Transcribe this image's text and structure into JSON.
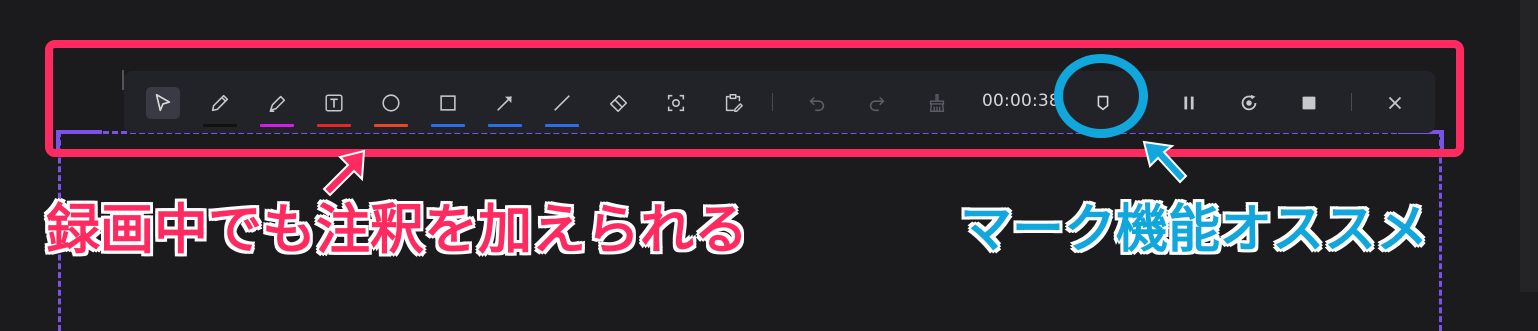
{
  "toolbar": {
    "timer": "00:00:38",
    "tools": [
      {
        "id": "select",
        "icon": "cursor-icon",
        "swatch": null
      },
      {
        "id": "pen",
        "icon": "pencil-icon",
        "swatch": "#111111"
      },
      {
        "id": "highlighter",
        "icon": "highlighter-icon",
        "swatch": "#d21ee8"
      },
      {
        "id": "text",
        "icon": "text-icon",
        "swatch": "#e8262a"
      },
      {
        "id": "circle",
        "icon": "circle-icon",
        "swatch": "#e8462a"
      },
      {
        "id": "rectangle",
        "icon": "rectangle-icon",
        "swatch": "#2a6fe8"
      },
      {
        "id": "arrow",
        "icon": "arrow-icon",
        "swatch": "#2a6fe8"
      },
      {
        "id": "line",
        "icon": "line-icon",
        "swatch": "#2a6fe8"
      },
      {
        "id": "eraser",
        "icon": "eraser-icon",
        "swatch": null
      },
      {
        "id": "spotlight",
        "icon": "spotlight-icon",
        "swatch": null
      },
      {
        "id": "clipboard",
        "icon": "clipboard-edit-icon",
        "swatch": null
      }
    ]
  },
  "annotations": {
    "left_caption": "録画中でも注釈を加えられる",
    "right_caption": "マーク機能オススメ"
  },
  "colors": {
    "highlight_pink": "#ff2b60",
    "highlight_blue": "#11a6dc",
    "frame_purple": "#7a52e8",
    "toolbar_bg": "#222229"
  }
}
